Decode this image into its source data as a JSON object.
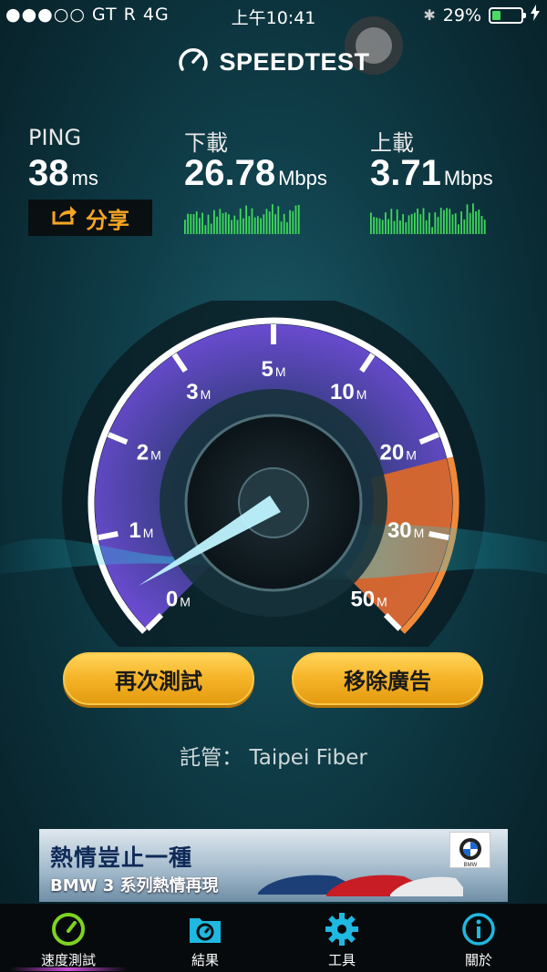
{
  "status_bar": {
    "carrier": "●●●○○ GT R   4G",
    "time": "上午10:41",
    "bluetooth": "✱",
    "battery_percent": "29%",
    "battery_level": 0.29,
    "charging_icon": "bolt-icon"
  },
  "app": {
    "title": "SPEEDTEST",
    "logo_icon": "speedometer-icon"
  },
  "stats": {
    "ping": {
      "label": "PING",
      "value": "38",
      "unit": "ms"
    },
    "download": {
      "label": "下載",
      "value": "26.78",
      "unit": "Mbps"
    },
    "upload": {
      "label": "上載",
      "value": "3.71",
      "unit": "Mbps"
    },
    "share_label": "分享"
  },
  "gauge": {
    "ticks": [
      {
        "value": "0",
        "unit": "M"
      },
      {
        "value": "1",
        "unit": "M"
      },
      {
        "value": "2",
        "unit": "M"
      },
      {
        "value": "3",
        "unit": "M"
      },
      {
        "value": "5",
        "unit": "M"
      },
      {
        "value": "10",
        "unit": "M"
      },
      {
        "value": "20",
        "unit": "M"
      },
      {
        "value": "30",
        "unit": "M"
      },
      {
        "value": "50",
        "unit": "M"
      }
    ],
    "colors": {
      "arc_purple": "#6a4bd0",
      "arc_orange": "#e0702a",
      "needle": "#7fe6ff"
    }
  },
  "buttons": {
    "retest": "再次測試",
    "remove_ads": "移除廣告"
  },
  "host": {
    "label": "託管：",
    "name": "Taipei Fiber"
  },
  "ad": {
    "headline": "熱情豈止一種",
    "subline": "BMW 3 系列熱情再現",
    "brand": "BMW"
  },
  "tabs": [
    {
      "label": "速度測試",
      "icon": "speedometer-icon",
      "active": true
    },
    {
      "label": "結果",
      "icon": "folder-gauge-icon",
      "active": false
    },
    {
      "label": "工具",
      "icon": "gear-icon",
      "active": false
    },
    {
      "label": "關於",
      "icon": "info-icon",
      "active": false
    }
  ],
  "colors": {
    "accent": "#f6a623",
    "green_bars": "#3fd85a",
    "tab_accent": "#1fb8e0"
  }
}
